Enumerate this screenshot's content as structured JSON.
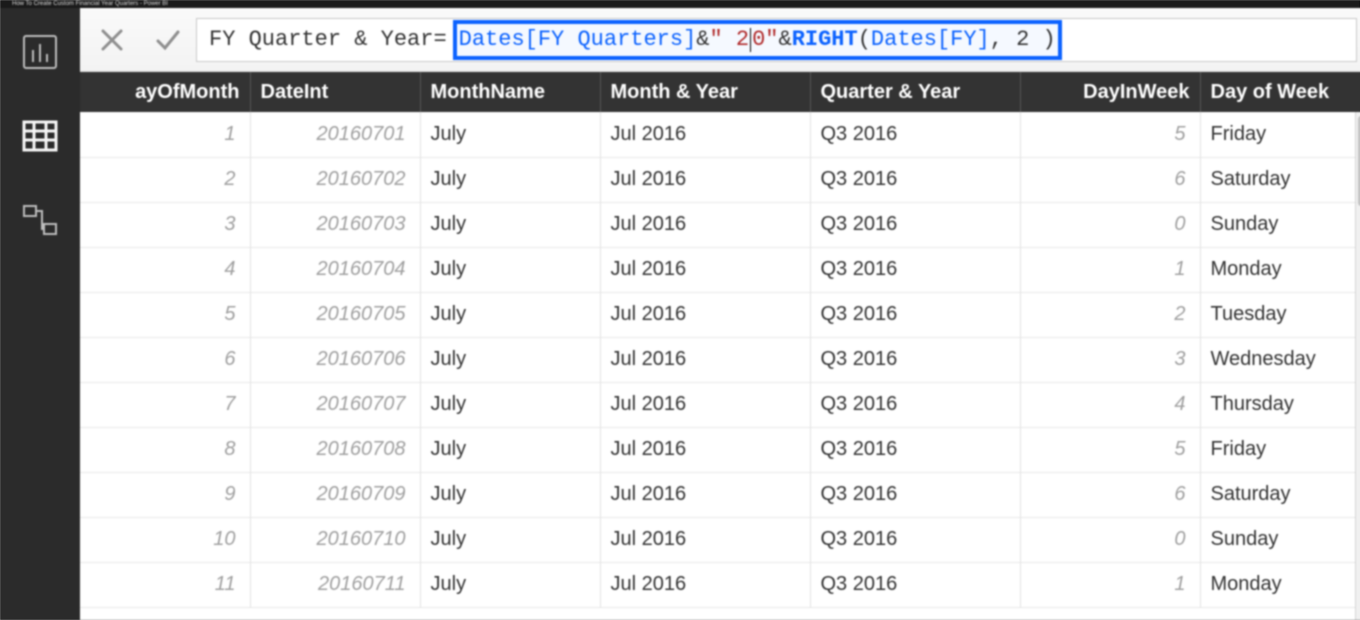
{
  "window": {
    "title_fragment": "How To Create Custom Financial Year Quarters - Power BI"
  },
  "nav": {
    "items": [
      "report-view",
      "data-view",
      "model-view"
    ],
    "active": 1
  },
  "formulaBar": {
    "measure_name": "FY Quarter & Year",
    "equals": " = ",
    "expr": {
      "col1": "Dates[FY Quarters]",
      "amp1": " & ",
      "str_open": "\" 2",
      "str_caret_after": "0",
      "str_close": "\"",
      "amp2": " & ",
      "func": "RIGHT",
      "paren_open": "( ",
      "col2": "Dates[FY]",
      "args_tail": ", 2 )"
    }
  },
  "table": {
    "headers": {
      "dayOfMonth": "ayOfMonth",
      "dateInt": "DateInt",
      "monthName": "MonthName",
      "monthYear": "Month & Year",
      "quarterYear": "Quarter & Year",
      "dayInWeek": "DayInWeek",
      "dayOfWeek": "Day of Week"
    },
    "rows": [
      {
        "dayOfMonth": "1",
        "dateInt": "20160701",
        "monthName": "July",
        "monthYear": "Jul 2016",
        "quarterYear": "Q3 2016",
        "dayInWeek": "5",
        "dayOfWeek": "Friday"
      },
      {
        "dayOfMonth": "2",
        "dateInt": "20160702",
        "monthName": "July",
        "monthYear": "Jul 2016",
        "quarterYear": "Q3 2016",
        "dayInWeek": "6",
        "dayOfWeek": "Saturday"
      },
      {
        "dayOfMonth": "3",
        "dateInt": "20160703",
        "monthName": "July",
        "monthYear": "Jul 2016",
        "quarterYear": "Q3 2016",
        "dayInWeek": "0",
        "dayOfWeek": "Sunday"
      },
      {
        "dayOfMonth": "4",
        "dateInt": "20160704",
        "monthName": "July",
        "monthYear": "Jul 2016",
        "quarterYear": "Q3 2016",
        "dayInWeek": "1",
        "dayOfWeek": "Monday"
      },
      {
        "dayOfMonth": "5",
        "dateInt": "20160705",
        "monthName": "July",
        "monthYear": "Jul 2016",
        "quarterYear": "Q3 2016",
        "dayInWeek": "2",
        "dayOfWeek": "Tuesday"
      },
      {
        "dayOfMonth": "6",
        "dateInt": "20160706",
        "monthName": "July",
        "monthYear": "Jul 2016",
        "quarterYear": "Q3 2016",
        "dayInWeek": "3",
        "dayOfWeek": "Wednesday"
      },
      {
        "dayOfMonth": "7",
        "dateInt": "20160707",
        "monthName": "July",
        "monthYear": "Jul 2016",
        "quarterYear": "Q3 2016",
        "dayInWeek": "4",
        "dayOfWeek": "Thursday"
      },
      {
        "dayOfMonth": "8",
        "dateInt": "20160708",
        "monthName": "July",
        "monthYear": "Jul 2016",
        "quarterYear": "Q3 2016",
        "dayInWeek": "5",
        "dayOfWeek": "Friday"
      },
      {
        "dayOfMonth": "9",
        "dateInt": "20160709",
        "monthName": "July",
        "monthYear": "Jul 2016",
        "quarterYear": "Q3 2016",
        "dayInWeek": "6",
        "dayOfWeek": "Saturday"
      },
      {
        "dayOfMonth": "10",
        "dateInt": "20160710",
        "monthName": "July",
        "monthYear": "Jul 2016",
        "quarterYear": "Q3 2016",
        "dayInWeek": "0",
        "dayOfWeek": "Sunday"
      },
      {
        "dayOfMonth": "11",
        "dateInt": "20160711",
        "monthName": "July",
        "monthYear": "Jul 2016",
        "quarterYear": "Q3 2016",
        "dayInWeek": "1",
        "dayOfWeek": "Monday"
      }
    ]
  }
}
